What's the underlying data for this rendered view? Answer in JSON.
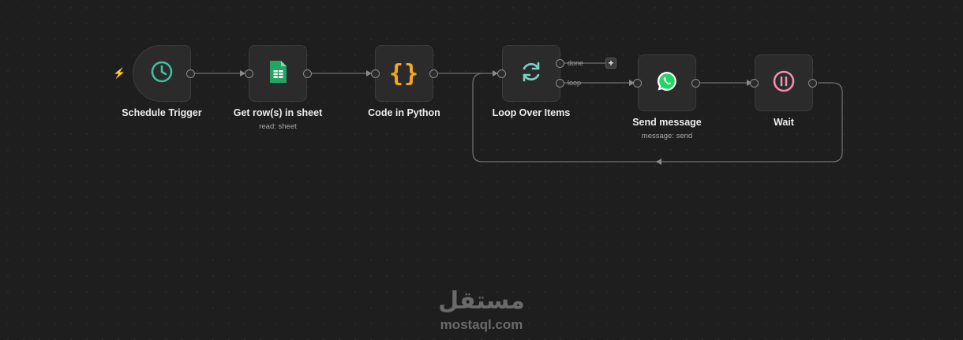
{
  "nodes": {
    "schedule_trigger": {
      "title": "Schedule Trigger",
      "icon": "clock-icon",
      "color": "#3fbf9f"
    },
    "get_rows": {
      "title": "Get row(s) in sheet",
      "subtitle": "read: sheet",
      "icon": "google-sheets-icon",
      "color": "#23a566"
    },
    "code": {
      "title": "Code in Python",
      "icon": "curly-braces-icon",
      "color": "#f5a623",
      "glyph": "{}"
    },
    "loop": {
      "title": "Loop Over Items",
      "icon": "refresh-icon",
      "color": "#7fd1c4",
      "outputs": {
        "done": "done",
        "loop": "loop"
      }
    },
    "send_message": {
      "title": "Send message",
      "subtitle": "message: send",
      "icon": "whatsapp-icon",
      "color": "#25d366"
    },
    "wait": {
      "title": "Wait",
      "icon": "pause-icon",
      "color": "#f08fb0"
    }
  },
  "add_button": "+",
  "trigger_badge": "⚡",
  "watermark": {
    "arabic": "مستقل",
    "url": "mostaql.com"
  }
}
